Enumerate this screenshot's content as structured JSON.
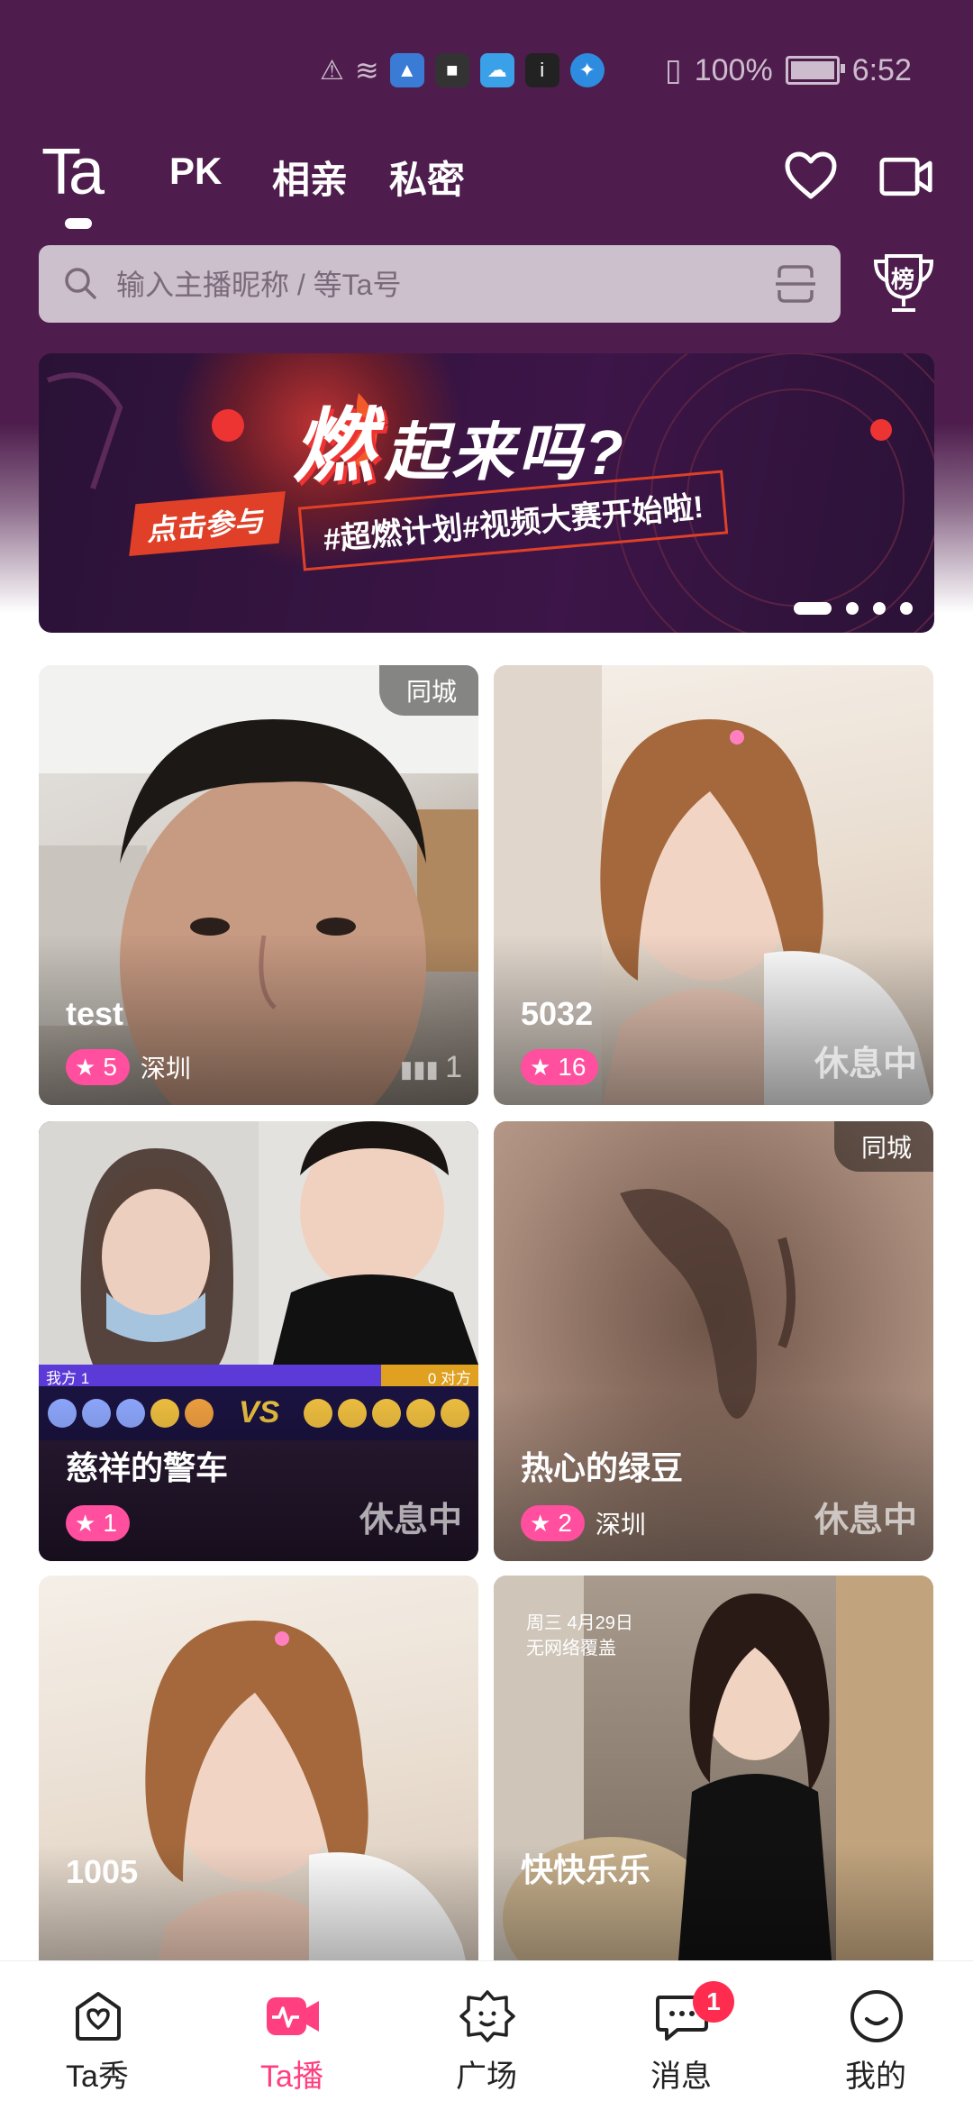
{
  "status_bar": {
    "battery": "100%",
    "time": "6:52",
    "battery_level": 1.0
  },
  "nav": {
    "logo": "Ta",
    "tabs": [
      {
        "label": "PK"
      },
      {
        "label": "相亲"
      },
      {
        "label": "私密"
      }
    ]
  },
  "search": {
    "placeholder": "输入主播昵称 / 等Ta号"
  },
  "trophy_label": "榜",
  "banner": {
    "title": "燃",
    "title_suffix": "起来吗?",
    "tag": "点击参与",
    "subtitle": "#超燃计划#视频大赛开始啦!",
    "page_count": 4,
    "current_page": 1
  },
  "cards": [
    {
      "name": "test",
      "level": "5",
      "city": "深圳",
      "corner": "同城",
      "status": "",
      "viewers": "1"
    },
    {
      "name": "5032",
      "level": "16",
      "city": "",
      "corner": "",
      "status": "休息中",
      "viewers": ""
    },
    {
      "name": "慈祥的警车",
      "level": "1",
      "city": "",
      "corner": "",
      "status": "休息中",
      "viewers": ""
    },
    {
      "name": "热心的绿豆",
      "level": "2",
      "city": "深圳",
      "corner": "同城",
      "status": "休息中",
      "viewers": ""
    },
    {
      "name": "1005",
      "level": "",
      "city": "",
      "corner": "",
      "status": "",
      "viewers": ""
    },
    {
      "name": "快快乐乐",
      "level": "",
      "city": "",
      "corner": "",
      "status": "",
      "viewers": ""
    }
  ],
  "pk_overlay": {
    "left": "我方 1",
    "right": "0 对方",
    "vs": "VS"
  },
  "card6_overlay": {
    "day": "周三 4月29日",
    "network": "无网络覆盖"
  },
  "tab_bar": {
    "tabs": [
      {
        "label": "Ta秀"
      },
      {
        "label": "Ta播"
      },
      {
        "label": "广场"
      },
      {
        "label": "消息"
      },
      {
        "label": "我的"
      }
    ],
    "active_index": 1,
    "message_badge": "1"
  },
  "colors": {
    "header": "#4e1d4d",
    "accent": "#ff3f7f",
    "badge": "#ff4f9e"
  }
}
